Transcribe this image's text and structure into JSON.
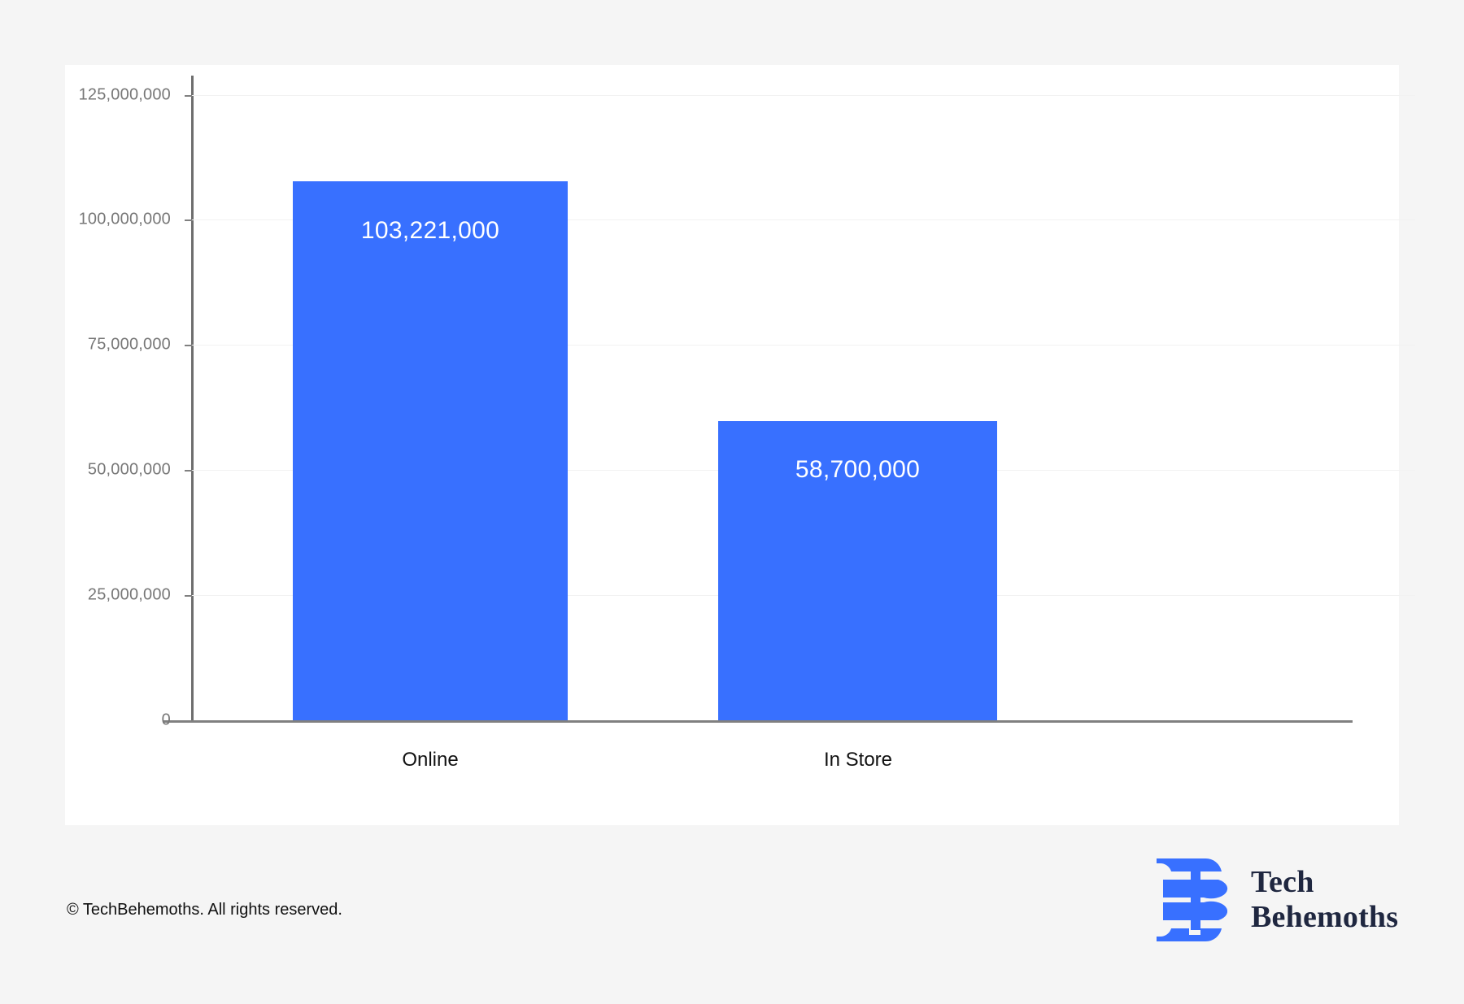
{
  "page": {
    "background_color": "#f5f5f5",
    "card_background_color": "#ffffff"
  },
  "chart_data": {
    "type": "bar",
    "title": "",
    "subtitle": "",
    "xlabel": "",
    "ylabel": "",
    "categories": [
      "Online",
      "In Store"
    ],
    "values": [
      103221000,
      58700000
    ],
    "value_labels": [
      "103,221,000",
      "58,700,000"
    ],
    "series": [
      {
        "name": "",
        "values": [
          103221000,
          58700000
        ]
      }
    ],
    "ylim": [
      0,
      127000000
    ],
    "yticks": [
      0,
      25000000,
      50000000,
      75000000,
      100000000,
      125000000
    ],
    "ytick_labels": [
      "0",
      "25,000,000",
      "50,000,000",
      "75,000,000",
      "100,000,000",
      "125,000,000"
    ],
    "grid": true,
    "grid_axis": "y",
    "legend": false,
    "legend_position": "none",
    "bar_color": "#3870ff",
    "value_label_color": "#ffffff",
    "axis_color": "#808080",
    "gridline_color": "#f2f2f2",
    "tick_label_color": "#777777",
    "category_label_color": "#111111"
  },
  "footer": {
    "copyright": "© TechBehemoths. All rights reserved."
  },
  "brand": {
    "name_line_1": "Tech",
    "name_line_2": "Behemoths",
    "mark_color": "#3870ff",
    "wordmark_color": "#1f2740"
  }
}
